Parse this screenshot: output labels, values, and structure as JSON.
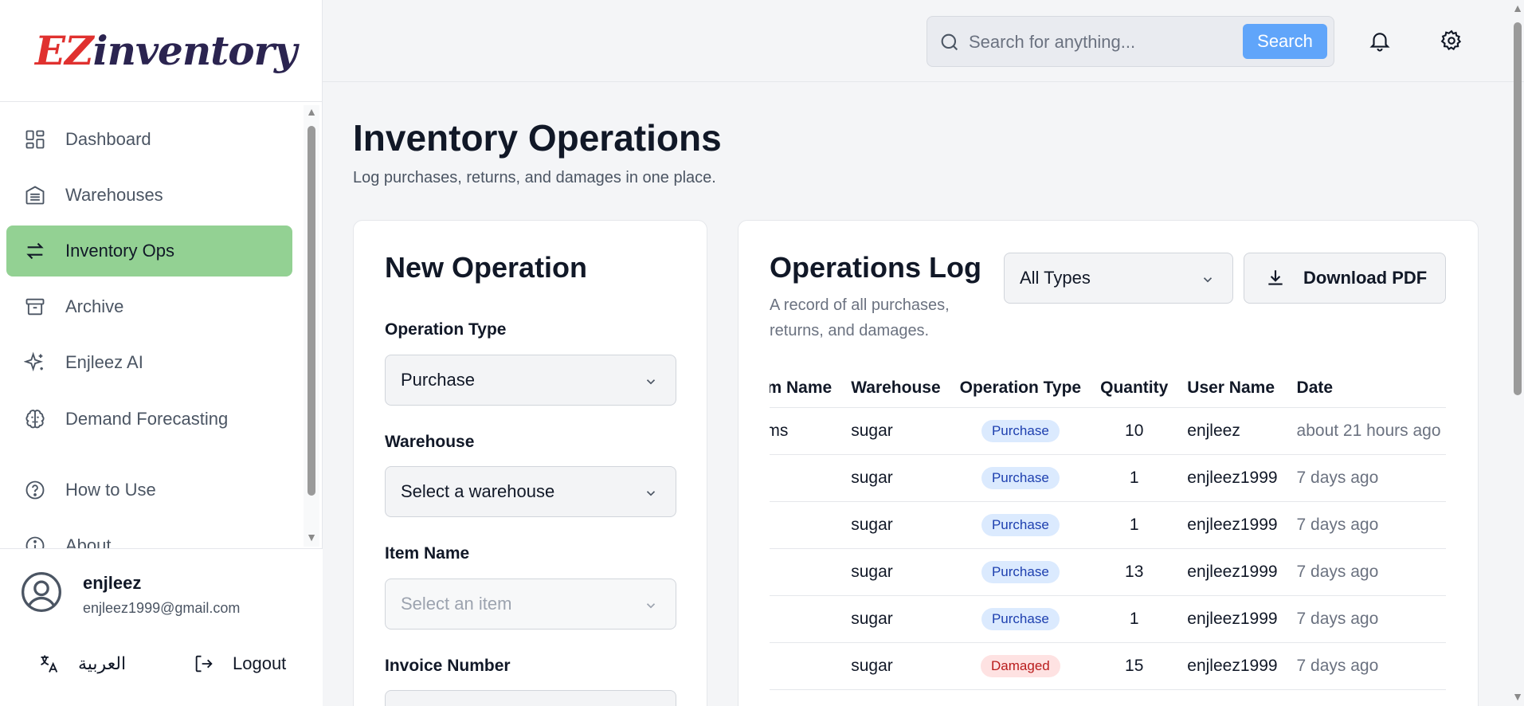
{
  "app": {
    "logo_ez": "EZ",
    "logo_rest": "inventory"
  },
  "sidebar": {
    "items": [
      {
        "label": "Dashboard",
        "icon": "dashboard-icon",
        "active": false
      },
      {
        "label": "Warehouses",
        "icon": "warehouse-icon",
        "active": false
      },
      {
        "label": "Inventory Ops",
        "icon": "arrows-swap-icon",
        "active": true
      },
      {
        "label": "Archive",
        "icon": "archive-icon",
        "active": false
      },
      {
        "label": "Enjleez AI",
        "icon": "sparkles-icon",
        "active": false
      },
      {
        "label": "Demand Forecasting",
        "icon": "brain-icon",
        "active": false
      },
      {
        "label": "How to Use",
        "icon": "help-circle-icon",
        "active": false
      },
      {
        "label": "About",
        "icon": "info-circle-icon",
        "active": false
      }
    ],
    "user": {
      "name": "enjleez",
      "email": "enjleez1999@gmail.com"
    },
    "language_label": "العربية",
    "logout_label": "Logout"
  },
  "topbar": {
    "search_placeholder": "Search for anything...",
    "search_button": "Search"
  },
  "page": {
    "title": "Inventory Operations",
    "subtitle": "Log purchases, returns, and damages in one place."
  },
  "new_operation": {
    "title": "New Operation",
    "operation_type_label": "Operation Type",
    "operation_type_value": "Purchase",
    "warehouse_label": "Warehouse",
    "warehouse_value": "Select a warehouse",
    "item_label": "Item Name",
    "item_placeholder": "Select an item",
    "invoice_label": "Invoice Number"
  },
  "operations_log": {
    "title": "Operations Log",
    "subtitle": "A record of all purchases, returns, and damages.",
    "filter_value": "All Types",
    "download_label": "Download PDF",
    "columns": [
      "Item Name",
      "Warehouse",
      "Operation Type",
      "Quantity",
      "User Name",
      "Date"
    ],
    "rows": [
      {
        "item": "Items",
        "warehouse": "sugar",
        "type": "Purchase",
        "quantity": "10",
        "user": "enjleez",
        "date": "about 21 hours ago"
      },
      {
        "item": "",
        "warehouse": "sugar",
        "type": "Purchase",
        "quantity": "1",
        "user": "enjleez1999",
        "date": "7 days ago"
      },
      {
        "item": "",
        "warehouse": "sugar",
        "type": "Purchase",
        "quantity": "1",
        "user": "enjleez1999",
        "date": "7 days ago"
      },
      {
        "item": "",
        "warehouse": "sugar",
        "type": "Purchase",
        "quantity": "13",
        "user": "enjleez1999",
        "date": "7 days ago"
      },
      {
        "item": "",
        "warehouse": "sugar",
        "type": "Purchase",
        "quantity": "1",
        "user": "enjleez1999",
        "date": "7 days ago"
      },
      {
        "item": "",
        "warehouse": "sugar",
        "type": "Damaged",
        "quantity": "15",
        "user": "enjleez1999",
        "date": "7 days ago"
      }
    ]
  },
  "colors": {
    "active_nav": "#93d193",
    "search_button": "#60a5fa",
    "purchase_badge": "#dbeafe",
    "damaged_badge": "#fee2e2"
  }
}
